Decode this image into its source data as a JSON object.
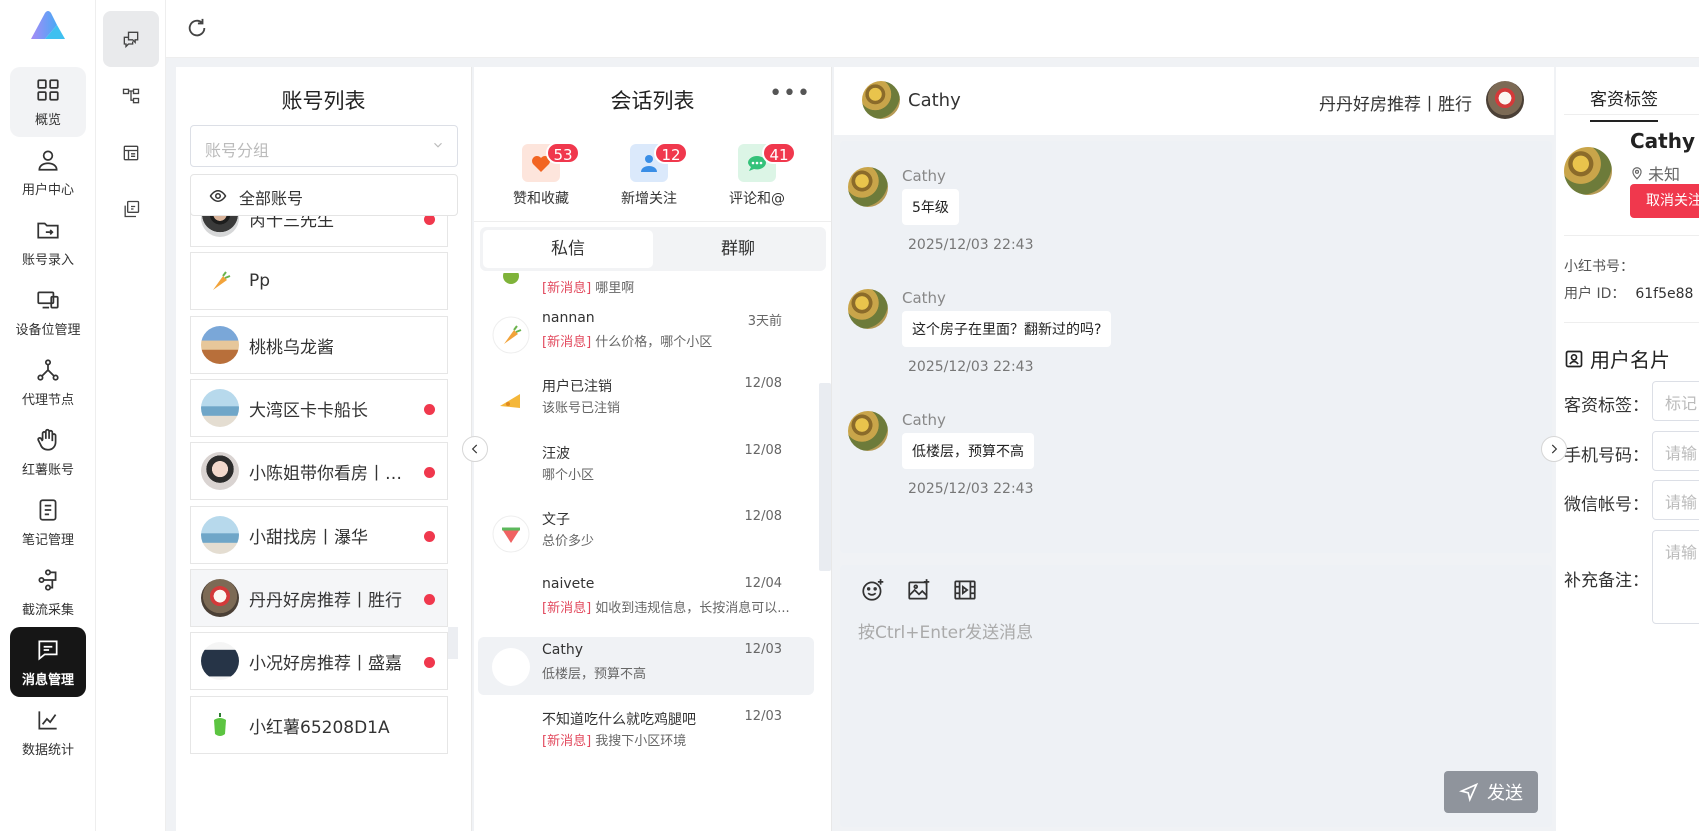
{
  "nav": {
    "items": [
      {
        "label": "概览",
        "icon": "dashboard-icon"
      },
      {
        "label": "用户中心",
        "icon": "user-icon"
      },
      {
        "label": "账号录入",
        "icon": "folder-sync-icon"
      },
      {
        "label": "设备位管理",
        "icon": "devices-icon"
      },
      {
        "label": "代理节点",
        "icon": "nodes-icon"
      },
      {
        "label": "红薯账号",
        "icon": "hand-icon"
      },
      {
        "label": "笔记管理",
        "icon": "note-icon"
      },
      {
        "label": "截流采集",
        "icon": "flow-icon"
      },
      {
        "label": "消息管理",
        "icon": "message-icon"
      },
      {
        "label": "数据统计",
        "icon": "chart-icon"
      }
    ],
    "active": "消息管理"
  },
  "accounts": {
    "title": "账号列表",
    "group_placeholder": "账号分组",
    "all_label": "全部账号",
    "items": [
      {
        "name": "芮十三先生",
        "dot": true
      },
      {
        "name": "Pp",
        "dot": false
      },
      {
        "name": "桃桃乌龙酱",
        "dot": false
      },
      {
        "name": "大湾区卡卡船长",
        "dot": true
      },
      {
        "name": "小陈姐带你看房丨…",
        "dot": true
      },
      {
        "name": "小甜找房丨瀑华",
        "dot": true
      },
      {
        "name": "丹丹好房推荐丨胜行",
        "dot": true
      },
      {
        "name": "小况好房推荐丨盛嘉",
        "dot": true
      },
      {
        "name": "小红薯65208D1A",
        "dot": false
      }
    ]
  },
  "conversations": {
    "title": "会话列表",
    "more": "•••",
    "notifs": [
      {
        "label": "赞和收藏",
        "count": "53"
      },
      {
        "label": "新增关注",
        "count": "12"
      },
      {
        "label": "评论和@",
        "count": "41"
      }
    ],
    "tabs": [
      "私信",
      "群聊"
    ],
    "new_tag": "[新消息]",
    "partial_preview": "哪里啊",
    "items": [
      {
        "name": "nannan",
        "time": "3天前",
        "new": true,
        "preview": "什么价格，哪个小区"
      },
      {
        "name": "用户已注销",
        "time": "12/08",
        "new": false,
        "preview": "该账号已注销"
      },
      {
        "name": "汪波",
        "time": "12/08",
        "new": false,
        "preview": "哪个小区"
      },
      {
        "name": "文子",
        "time": "12/08",
        "new": false,
        "preview": "总价多少"
      },
      {
        "name": "naivete",
        "time": "12/04",
        "new": true,
        "preview": "如收到违规信息，长按消息可以..."
      },
      {
        "name": "Cathy",
        "time": "12/03",
        "new": false,
        "preview": "低楼层，预算不高"
      },
      {
        "name": "不知道吃什么就吃鸡腿吧",
        "time": "12/03",
        "new": true,
        "preview": "我搜下小区环境"
      }
    ]
  },
  "chat": {
    "contact": "Cathy",
    "account": "丹丹好房推荐丨胜行",
    "messages": [
      {
        "sender": "Cathy",
        "text": "5年级",
        "time": "2025/12/03 22:43"
      },
      {
        "sender": "Cathy",
        "text": "这个房子在里面？翻新过的吗?",
        "time": "2025/12/03 22:43"
      },
      {
        "sender": "Cathy",
        "text": "低楼层，预算不高",
        "time": "2025/12/03 22:43"
      }
    ],
    "input_placeholder": "按Ctrl+Enter发送消息",
    "send_label": "发送"
  },
  "profile": {
    "tab": "客资标签",
    "name": "Cathy",
    "location": "未知",
    "unfollow": "取消关注",
    "xhs_label": "小红书号：",
    "uid_label": "用户 ID：",
    "uid_value": "61f5e88",
    "card_title": "用户名片",
    "fields": [
      {
        "label": "客资标签：",
        "placeholder": "标记"
      },
      {
        "label": "手机号码：",
        "placeholder": "请输"
      },
      {
        "label": "微信帐号：",
        "placeholder": "请输"
      },
      {
        "label": "补充备注：",
        "placeholder": "请输"
      }
    ]
  },
  "colors": {
    "accent": "#f0384d",
    "active_nav": "#161616",
    "send_button": "#8f949c"
  }
}
